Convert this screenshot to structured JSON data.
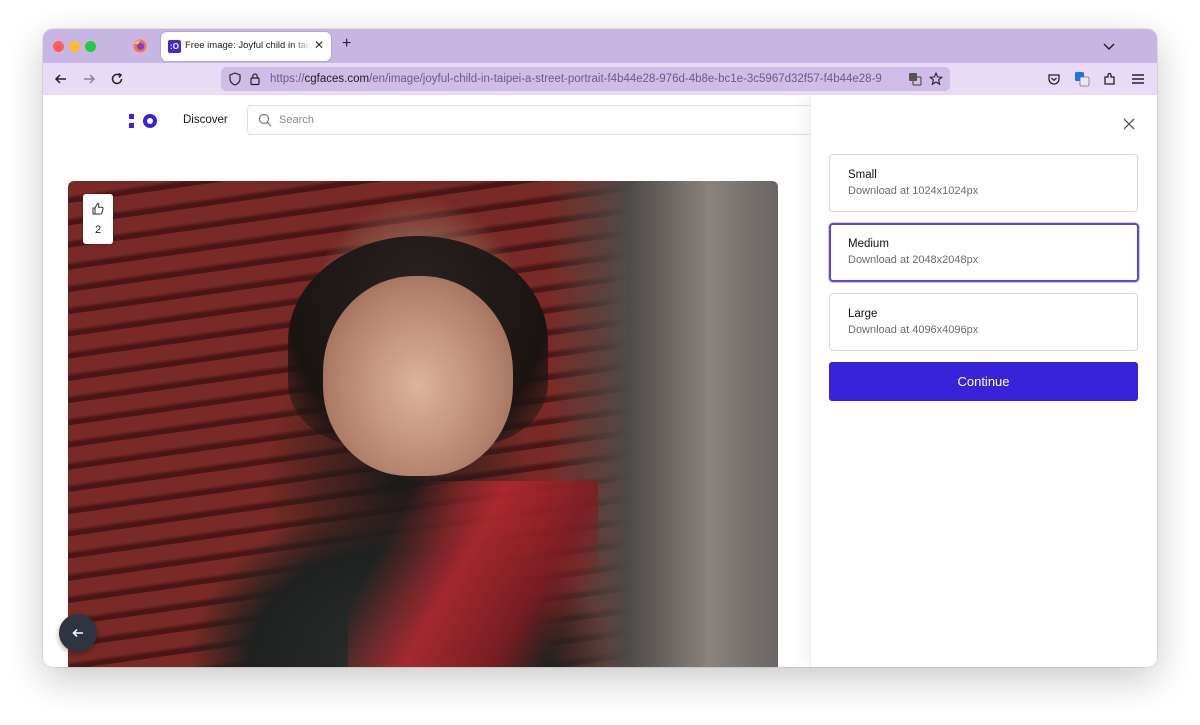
{
  "browser": {
    "tab_title": "Free image: Joyful child in taipei",
    "url_prefix": "https://",
    "url_domain": "cgfaces.com",
    "url_path": "/en/image/joyful-child-in-taipei-a-street-portrait-f4b44e28-976d-4b8e-bc1e-3c5967d32f57-f4b44e28-9"
  },
  "header": {
    "discover_label": "Discover",
    "search_placeholder": "Search"
  },
  "photo": {
    "like_count": "2"
  },
  "download_panel": {
    "options": [
      {
        "label": "Small",
        "description": "Download at 1024x1024px",
        "selected": false
      },
      {
        "label": "Medium",
        "description": "Download at 2048x2048px",
        "selected": true
      },
      {
        "label": "Large",
        "description": "Download at 4096x4096px",
        "selected": false
      }
    ],
    "continue_label": "Continue"
  },
  "colors": {
    "accent": "#3a22d8",
    "selected_border": "#5a4bd6",
    "browser_chrome": "#c7b6e4"
  }
}
